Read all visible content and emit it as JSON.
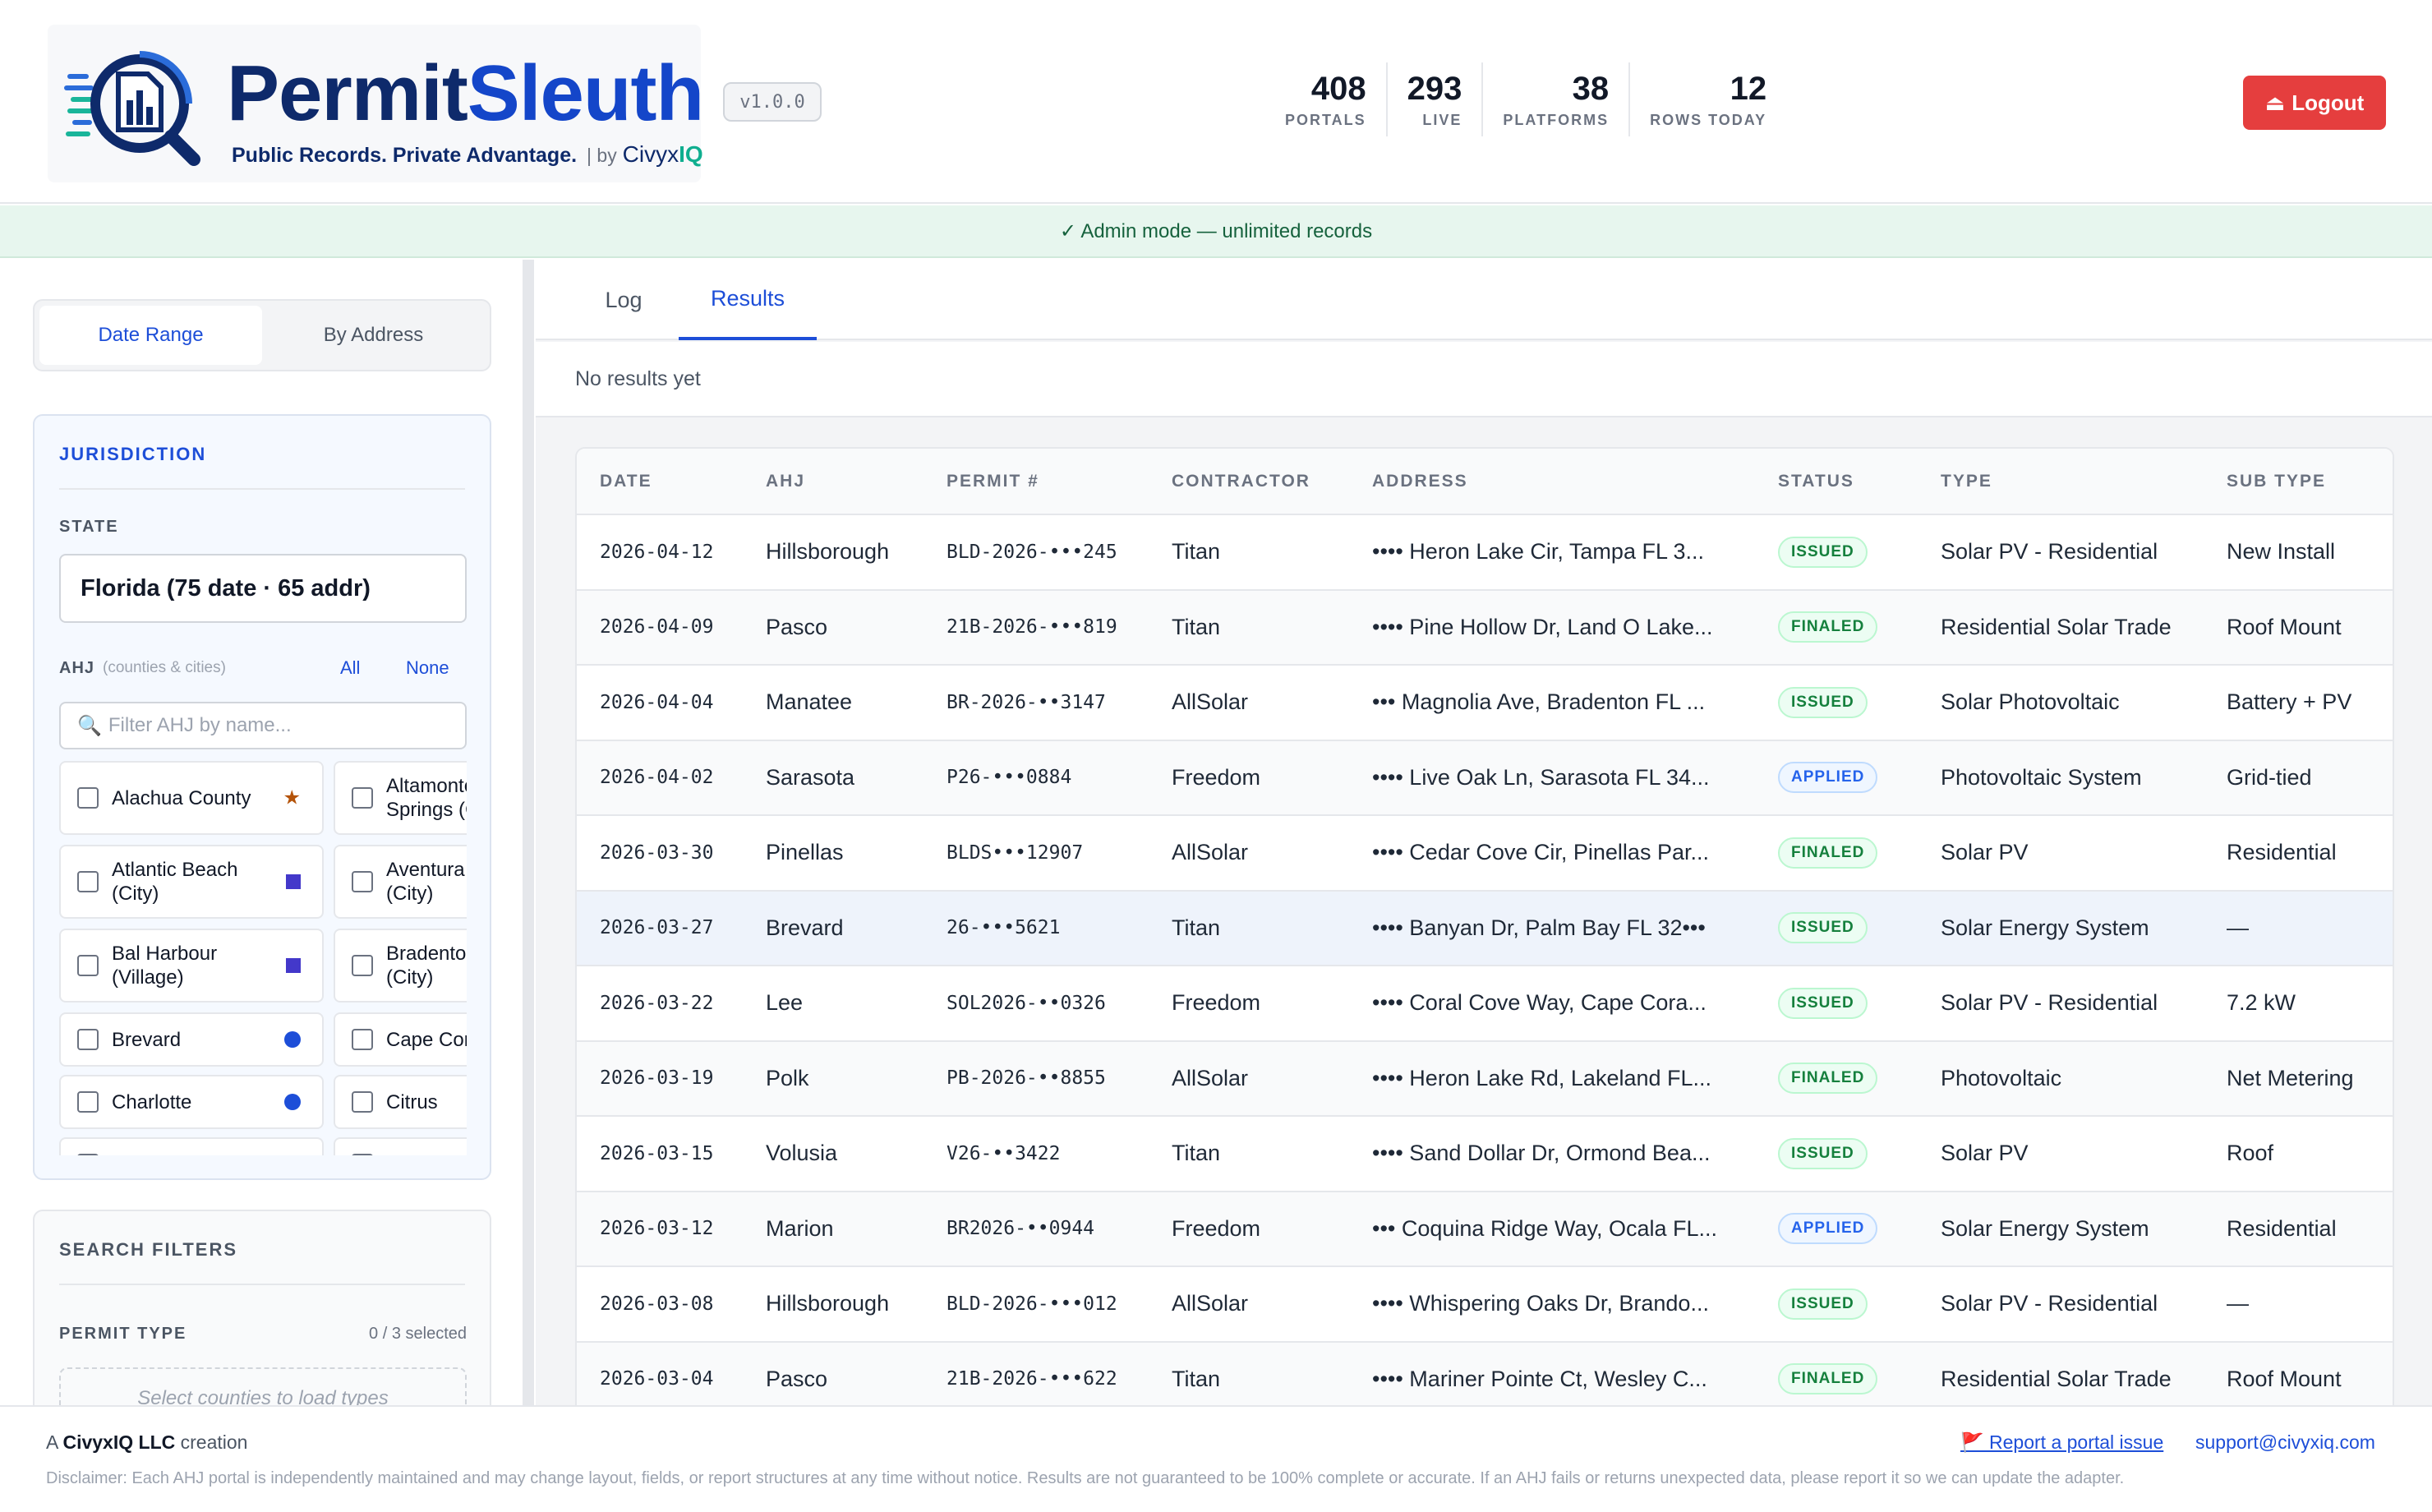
{
  "brand": {
    "name_part1": "Permit",
    "name_part2": "Sleuth",
    "tagline": "Public Records. Private Advantage.",
    "by": "| by",
    "partner_part1": "Civyx",
    "partner_part2": "IQ",
    "version": "v1.0.0"
  },
  "stats": [
    {
      "value": "408",
      "label": "PORTALS"
    },
    {
      "value": "293",
      "label": "LIVE"
    },
    {
      "value": "38",
      "label": "PLATFORMS"
    },
    {
      "value": "12",
      "label": "ROWS TODAY"
    }
  ],
  "logout": {
    "label": "Logout",
    "icon": "eject-icon",
    "color": "#e53e3e"
  },
  "banner": {
    "text": "✓ Admin mode — unlimited records"
  },
  "mode_tabs": [
    {
      "label": "Date Range",
      "active": true
    },
    {
      "label": "By Address",
      "active": false
    }
  ],
  "jurisdiction": {
    "title": "JURISDICTION",
    "state_label": "STATE",
    "state_value": "Florida (75 date · 65 addr)",
    "ahj_label": "AHJ",
    "ahj_sub": "(counties & cities)",
    "all": "All",
    "none": "None",
    "filter_placeholder": "Filter AHJ by name...",
    "items": [
      {
        "name": "Alachua County",
        "marker": "star"
      },
      {
        "name": "Altamonte Springs (City)",
        "marker": ""
      },
      {
        "name": "Atlantic Beach (City)",
        "marker": "square"
      },
      {
        "name": "Aventura (City)",
        "marker": ""
      },
      {
        "name": "Bal Harbour (Village)",
        "marker": "square"
      },
      {
        "name": "Bradenton (City)",
        "marker": ""
      },
      {
        "name": "Brevard",
        "marker": "dot"
      },
      {
        "name": "Cape Coral (City)",
        "marker": ""
      },
      {
        "name": "Charlotte",
        "marker": "dot"
      },
      {
        "name": "Citrus",
        "marker": ""
      }
    ]
  },
  "search_filters": {
    "title": "SEARCH FILTERS",
    "permit_type_label": "PERMIT TYPE",
    "permit_type_count": "0 / 3 selected",
    "placeholder": "Select counties to load types"
  },
  "result_tabs": [
    {
      "label": "Log",
      "active": false
    },
    {
      "label": "Results",
      "active": true
    }
  ],
  "no_results": "No results yet",
  "table": {
    "columns": [
      "DATE",
      "AHJ",
      "PERMIT #",
      "CONTRACTOR",
      "ADDRESS",
      "STATUS",
      "TYPE",
      "SUB TYPE"
    ],
    "rows": [
      [
        "2026-04-12",
        "Hillsborough",
        "BLD-2026-•••245",
        "Titan",
        "•••• Heron Lake Cir, Tampa FL 3...",
        "ISSUED",
        "Solar PV - Residential",
        "New Install"
      ],
      [
        "2026-04-09",
        "Pasco",
        "21B-2026-•••819",
        "Titan",
        "•••• Pine Hollow Dr, Land O Lake...",
        "FINALED",
        "Residential Solar Trade",
        "Roof Mount"
      ],
      [
        "2026-04-04",
        "Manatee",
        "BR-2026-••3147",
        "AllSolar",
        "••• Magnolia Ave, Bradenton FL ...",
        "ISSUED",
        "Solar Photovoltaic",
        "Battery + PV"
      ],
      [
        "2026-04-02",
        "Sarasota",
        "P26-•••0884",
        "Freedom",
        "•••• Live Oak Ln, Sarasota FL 34...",
        "APPLIED",
        "Photovoltaic System",
        "Grid-tied"
      ],
      [
        "2026-03-30",
        "Pinellas",
        "BLDS•••12907",
        "AllSolar",
        "•••• Cedar Cove Cir, Pinellas Par...",
        "FINALED",
        "Solar PV",
        "Residential"
      ],
      [
        "2026-03-27",
        "Brevard",
        "26-•••5621",
        "Titan",
        "•••• Banyan Dr, Palm Bay FL 32•••",
        "ISSUED",
        "Solar Energy System",
        "—"
      ],
      [
        "2026-03-22",
        "Lee",
        "SOL2026-••0326",
        "Freedom",
        "•••• Coral Cove Way, Cape Cora...",
        "ISSUED",
        "Solar PV - Residential",
        "7.2 kW"
      ],
      [
        "2026-03-19",
        "Polk",
        "PB-2026-••8855",
        "AllSolar",
        "•••• Heron Lake Rd, Lakeland FL...",
        "FINALED",
        "Photovoltaic",
        "Net Metering"
      ],
      [
        "2026-03-15",
        "Volusia",
        "V26-••3422",
        "Titan",
        "•••• Sand Dollar Dr, Ormond Bea...",
        "ISSUED",
        "Solar PV",
        "Roof"
      ],
      [
        "2026-03-12",
        "Marion",
        "BR2026-••0944",
        "Freedom",
        "••• Coquina Ridge Way, Ocala FL...",
        "APPLIED",
        "Solar Energy System",
        "Residential"
      ],
      [
        "2026-03-08",
        "Hillsborough",
        "BLD-2026-•••012",
        "AllSolar",
        "•••• Whispering Oaks Dr, Brando...",
        "ISSUED",
        "Solar PV - Residential",
        "—"
      ],
      [
        "2026-03-04",
        "Pasco",
        "21B-2026-•••622",
        "Titan",
        "•••• Mariner Pointe Ct, Wesley C...",
        "FINALED",
        "Residential Solar Trade",
        "Roof Mount"
      ]
    ]
  },
  "footer": {
    "prefix": "A",
    "company": "CivyxIQ LLC",
    "suffix": "creation",
    "report": "🚩 Report a portal issue",
    "support": "support@civyxiq.com",
    "disclaimer": "Disclaimer: Each AHJ portal is independently maintained and may change layout, fields, or report structures at any time without notice. Results are not guaranteed to be 100% complete or accurate. If an AHJ fails or returns unexpected data, please report it so we can update the adapter."
  }
}
